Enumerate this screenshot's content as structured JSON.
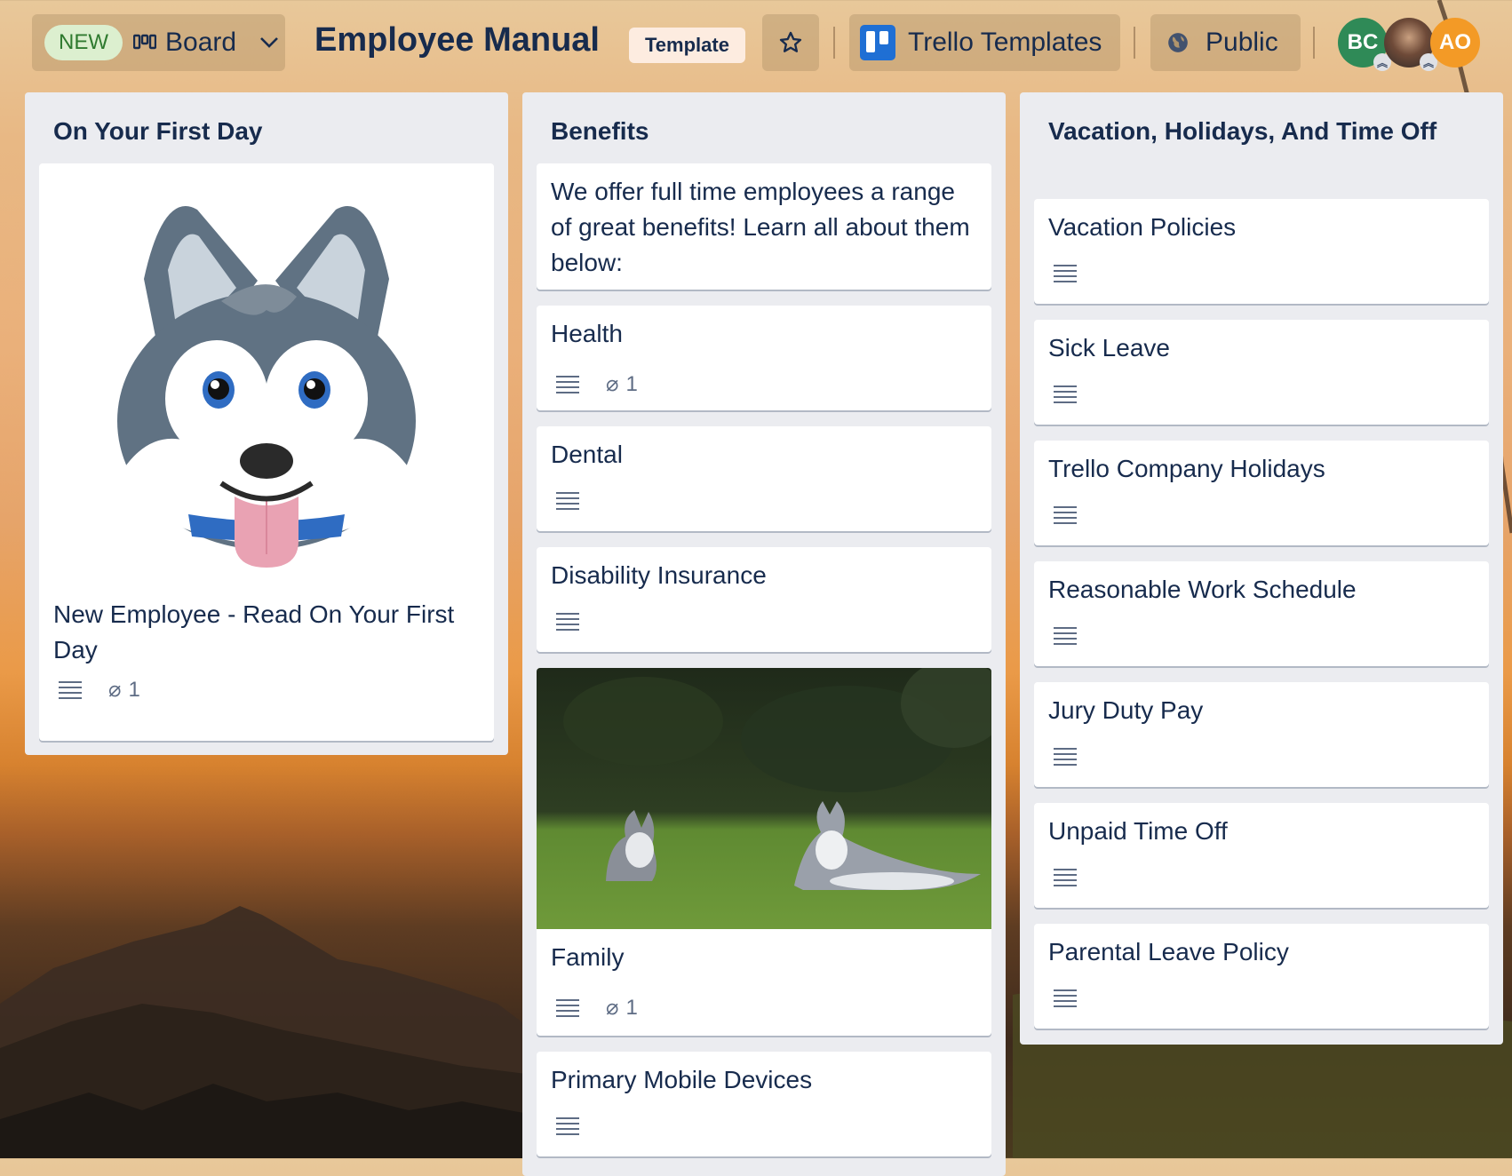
{
  "header": {
    "new_badge": "NEW",
    "board_view_label": "Board",
    "board_title": "Employee Manual",
    "template_badge": "Template",
    "workspace_label": "Trello Templates",
    "visibility_label": "Public",
    "members": [
      {
        "initials": "BC",
        "color": "#2f8a57"
      },
      {
        "initials": "",
        "color": "#6e4a38"
      },
      {
        "initials": "AO",
        "color": "#f39a26"
      }
    ]
  },
  "lists": [
    {
      "title": "On Your First Day",
      "cards": [
        {
          "title": "New Employee - Read On Your First Day",
          "has_description": true,
          "attachments": "1",
          "cover": "husky-illustration"
        }
      ]
    },
    {
      "title": "Benefits",
      "cards": [
        {
          "title": "We offer full time employees a range of great benefits! Learn all about them below:",
          "has_description": false
        },
        {
          "title": "Health",
          "has_description": true,
          "attachments": "1"
        },
        {
          "title": "Dental",
          "has_description": true
        },
        {
          "title": "Disability Insurance",
          "has_description": true
        },
        {
          "title": "Family",
          "has_description": true,
          "attachments": "1",
          "cover": "huskies-on-grass-photo"
        },
        {
          "title": "Primary Mobile Devices",
          "has_description": true
        }
      ]
    },
    {
      "title": "Vacation, Holidays, And Time Off",
      "cards": [
        {
          "title": "Vacation Policies",
          "has_description": true
        },
        {
          "title": "Sick Leave",
          "has_description": true
        },
        {
          "title": "Trello Company Holidays",
          "has_description": true
        },
        {
          "title": "Reasonable Work Schedule",
          "has_description": true
        },
        {
          "title": "Jury Duty Pay",
          "has_description": true
        },
        {
          "title": "Unpaid Time Off",
          "has_description": true
        },
        {
          "title": "Parental Leave Policy",
          "has_description": true
        }
      ]
    }
  ],
  "colors": {
    "accent": "#1f6fd4",
    "list_bg": "#ebecf0",
    "text": "#172b4d",
    "new_badge_bg": "#dcefcf"
  }
}
